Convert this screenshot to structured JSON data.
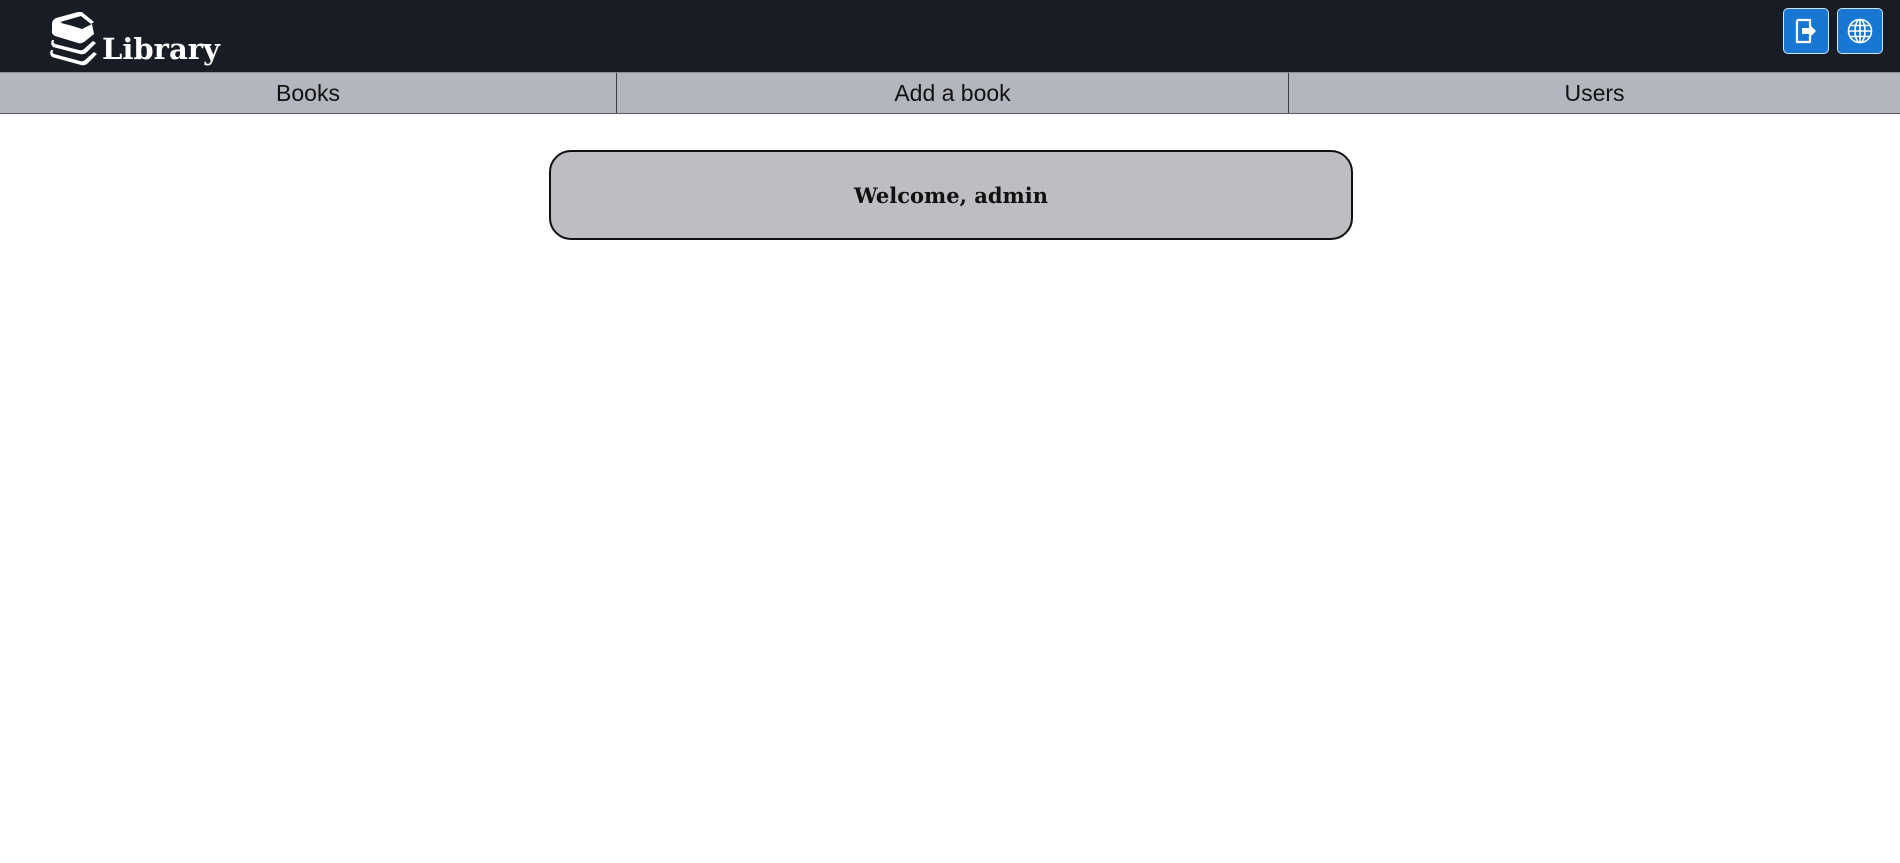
{
  "header": {
    "title": "Library",
    "logo_icon": "books-stack-icon",
    "actions": [
      {
        "name": "logout-button",
        "icon": "logout-icon"
      },
      {
        "name": "language-button",
        "icon": "globe-icon"
      }
    ],
    "colors": {
      "background": "#181c24",
      "button": "#1777d3"
    }
  },
  "nav": {
    "items": [
      {
        "label": "Books"
      },
      {
        "label": "Add a book"
      },
      {
        "label": "Users"
      }
    ],
    "background": "#b4b6bf"
  },
  "main": {
    "welcome": "Welcome, admin",
    "card_color": "#bdbdc2"
  }
}
